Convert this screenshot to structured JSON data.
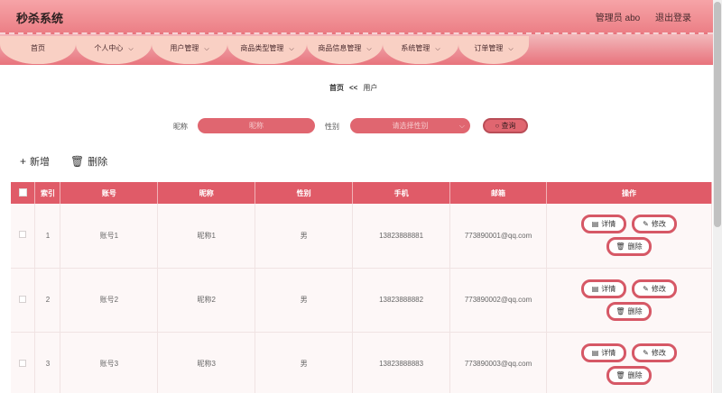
{
  "header": {
    "title": "秒杀系统",
    "user": "管理员 abo",
    "logout": "退出登录"
  },
  "nav": [
    {
      "label": "首页",
      "chevron": false
    },
    {
      "label": "个人中心",
      "chevron": true
    },
    {
      "label": "用户管理",
      "chevron": true
    },
    {
      "label": "商品类型管理",
      "chevron": true
    },
    {
      "label": "商品信息管理",
      "chevron": true
    },
    {
      "label": "系统管理",
      "chevron": true
    },
    {
      "label": "订单管理",
      "chevron": true
    }
  ],
  "breadcrumb": {
    "home": "首页",
    "sep": "<<",
    "current": "用户"
  },
  "search": {
    "nickname_label": "昵称",
    "nickname_placeholder": "昵称",
    "gender_label": "性别",
    "gender_placeholder": "请选择性别",
    "query_button": "查询"
  },
  "toolbar": {
    "add": "新增",
    "delete": "删除"
  },
  "table": {
    "headers": [
      "索引",
      "账号",
      "昵称",
      "性别",
      "手机",
      "邮箱",
      "操作"
    ],
    "rows": [
      {
        "index": "1",
        "account": "账号1",
        "nickname": "昵称1",
        "gender": "男",
        "phone": "13823888881",
        "email": "773890001@qq.com"
      },
      {
        "index": "2",
        "account": "账号2",
        "nickname": "昵称2",
        "gender": "男",
        "phone": "13823888882",
        "email": "773890002@qq.com"
      },
      {
        "index": "3",
        "account": "账号3",
        "nickname": "昵称3",
        "gender": "男",
        "phone": "13823888883",
        "email": "773890003@qq.com"
      }
    ],
    "actions": {
      "detail": "详情",
      "edit": "修改",
      "delete": "删除"
    }
  },
  "colors": {
    "accent": "#e05b68",
    "header_start": "#f6a4a7",
    "header_end": "#ec7f86"
  }
}
